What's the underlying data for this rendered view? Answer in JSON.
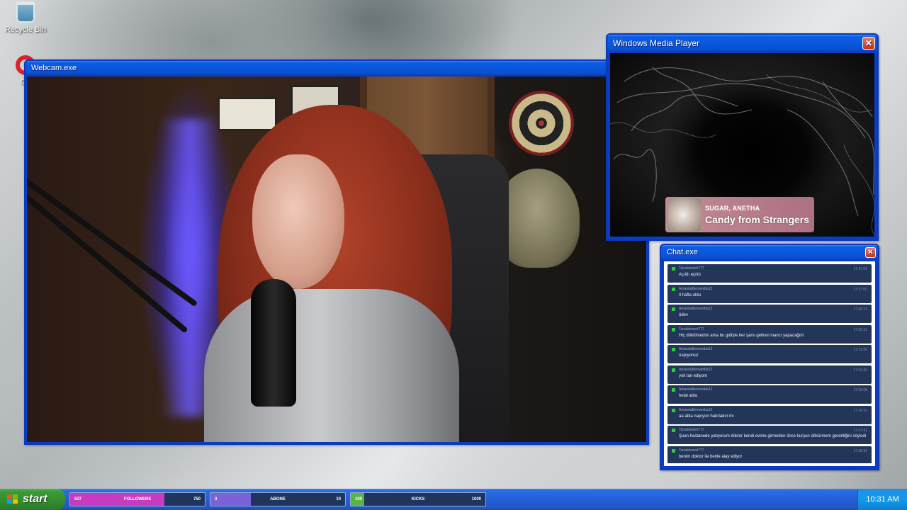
{
  "desktop": {
    "icons": [
      {
        "label": "Recycle Bin",
        "icon": "recycle-bin-icon"
      },
      {
        "label": "Op",
        "icon": "opera-icon"
      }
    ]
  },
  "webcam_window": {
    "title": "Webcam.exe"
  },
  "media_window": {
    "title": "Windows Media Player",
    "now_playing": {
      "artist": "SUGAR, ANETHA",
      "title": "Candy from Strangers"
    }
  },
  "chat_window": {
    "title": "Chat.exe",
    "messages": [
      {
        "user": "Tanakdesert777",
        "time": "17:27:09",
        "text": "Açıldı açıldı"
      },
      {
        "user": "AmandaBernamba12",
        "time": "17:27:00",
        "text": "Il hafta oldu"
      },
      {
        "user": "AmandaBernamba12",
        "time": "17:30:12",
        "text": "ödev"
      },
      {
        "user": "Tanakdesert777",
        "time": "17:30:12",
        "text": "Hiç dökülmedim ama bu gidişle her şans getiren inancı yapacağım"
      },
      {
        "user": "AmandaBernamba12",
        "time": "17:31:50",
        "text": "napıyonuz"
      },
      {
        "user": "AmandaBernamba12",
        "time": "17:32:46",
        "text": "yok lan ediyom"
      },
      {
        "user": "AmandaBernamba12",
        "time": "17:36:08",
        "text": "helal abla"
      },
      {
        "user": "AmandaBernamba12",
        "time": "17:36:15",
        "text": "aa abla napıyon hatırladın mı"
      },
      {
        "user": "Tanakdesert777",
        "time": "17:37:41",
        "text": "Şuan hastanede yatıyorum doktor kendi evime girmeden önce kurşun dökürmem gerektiğini söyledi"
      },
      {
        "user": "Tanakdesert777",
        "time": "17:38:32",
        "text": "benim doktor ile benle alay ediyor"
      }
    ]
  },
  "taskbar": {
    "start_label": "start",
    "goals": [
      {
        "count": "537",
        "label": "FOLLOWERS",
        "target": "750",
        "progress": 0.7,
        "color": "#c63bbf"
      },
      {
        "count": "3",
        "label": "ABONE",
        "target": "10",
        "progress": 0.3,
        "color": "#7b62d6"
      },
      {
        "count": "100",
        "label": "KICKS",
        "target": "1000",
        "progress": 0.1,
        "color": "#57b548"
      }
    ],
    "clock": "10:31 AM"
  },
  "colors": {
    "xp_blue": "#0a3cc8",
    "start_green": "#3a9a36",
    "chat_bg": "#23365a"
  }
}
